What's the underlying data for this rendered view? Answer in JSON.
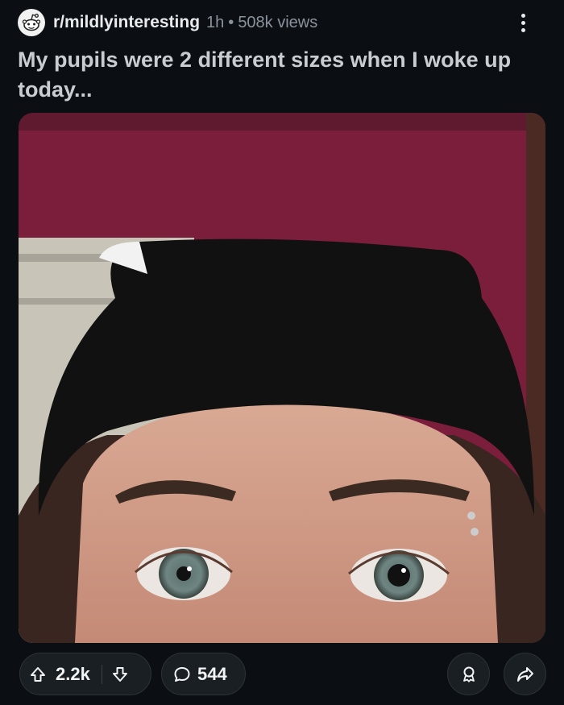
{
  "post": {
    "subreddit": "r/mildlyinteresting",
    "age": "1h",
    "separator": "•",
    "views": "508k views",
    "title": "My pupils were 2 different sizes when I woke up today..."
  },
  "actions": {
    "score": "2.2k",
    "comments": "544"
  },
  "icons": {
    "subreddit_avatar": "reddit-snoo-icon",
    "menu": "kebab-menu-icon",
    "upvote": "upvote-arrow-icon",
    "downvote": "downvote-arrow-icon",
    "comments": "comment-bubble-icon",
    "award": "award-icon",
    "share": "share-arrow-icon"
  },
  "colors": {
    "background": "#0b0f13",
    "button_bg": "#1a1f24",
    "title_text": "#c9ccd0",
    "meta_text": "#8a939b"
  }
}
